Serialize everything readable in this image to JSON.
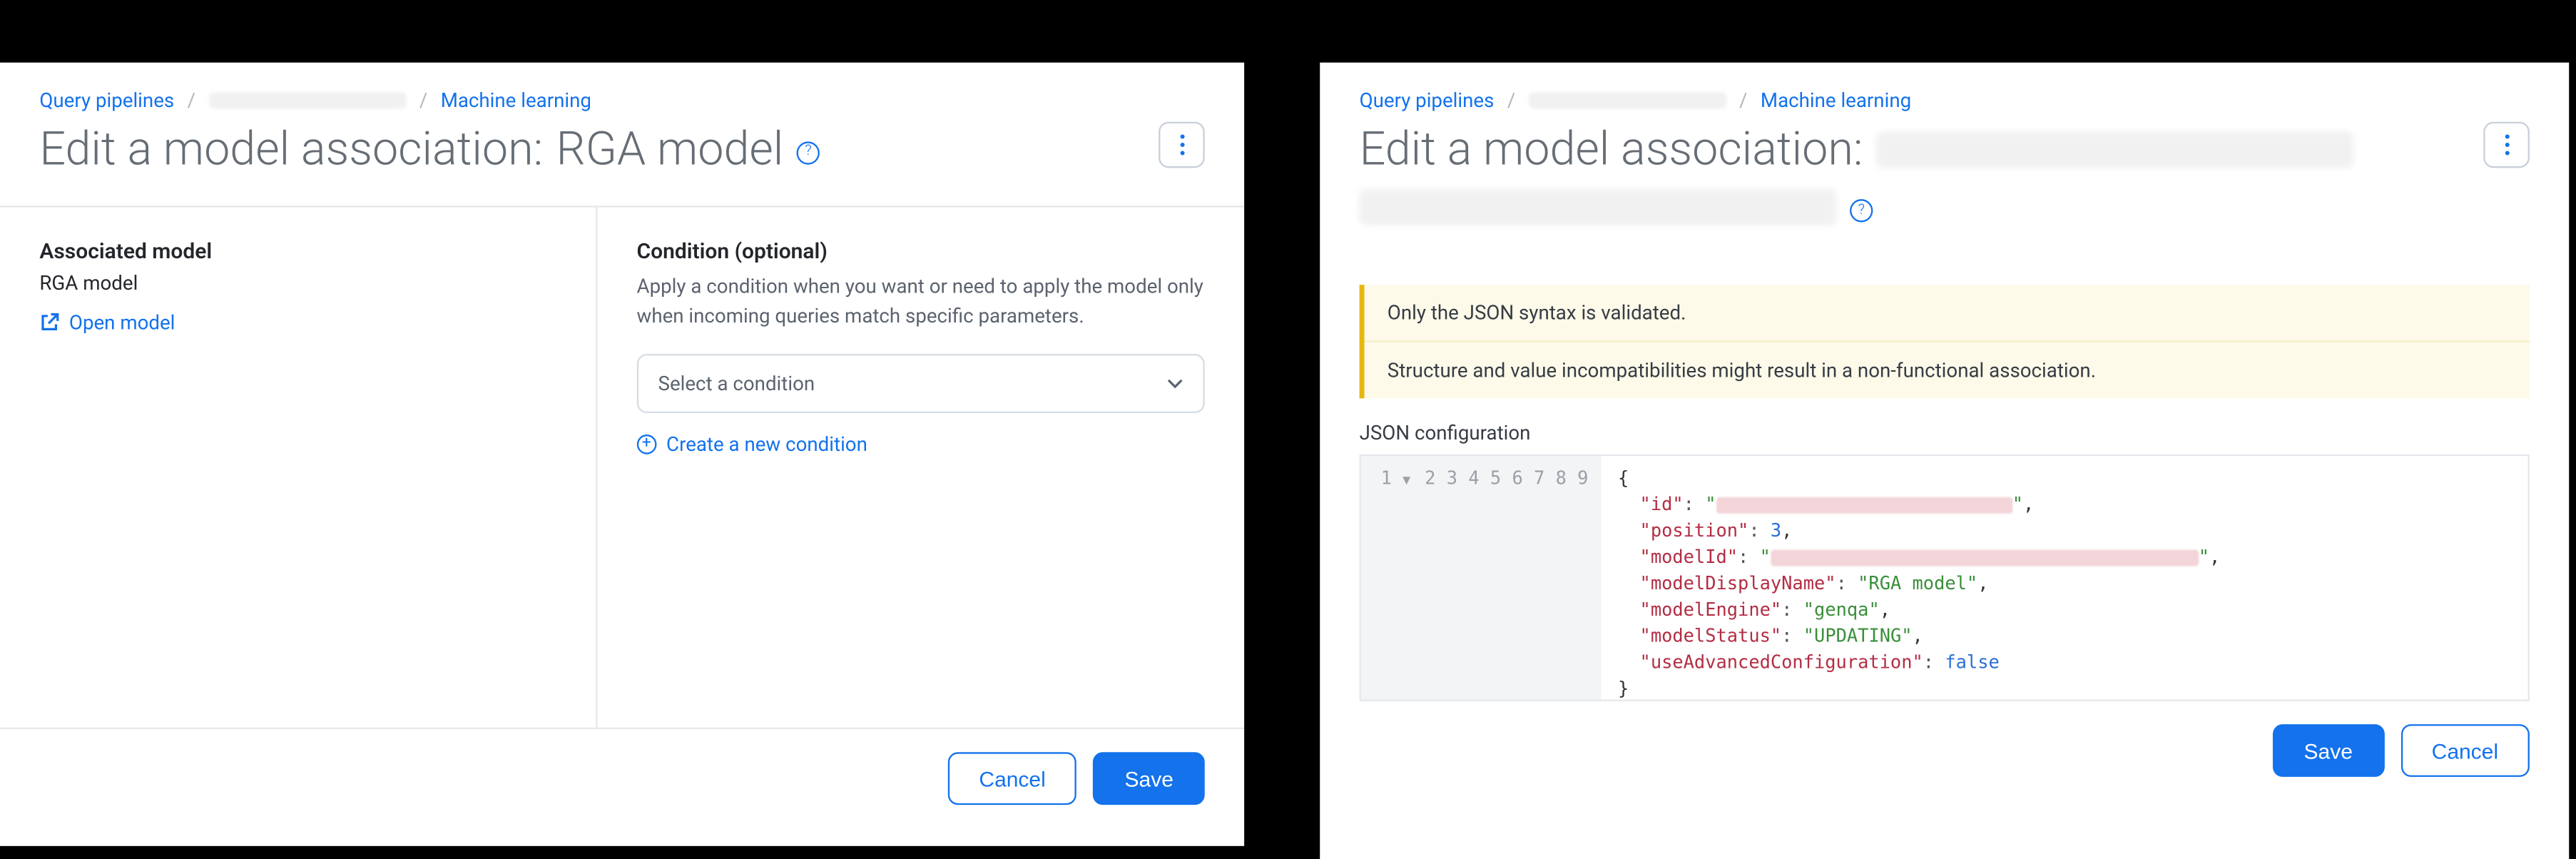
{
  "left": {
    "breadcrumb": {
      "root": "Query pipelines",
      "ml": "Machine learning"
    },
    "title_prefix": "Edit a model association:",
    "title_model": "RGA model",
    "associated": {
      "heading": "Associated model",
      "model_name": "RGA model",
      "open_link": "Open model"
    },
    "condition": {
      "heading": "Condition (optional)",
      "description": "Apply a condition when you want or need to apply the model only when incoming queries match specific parameters.",
      "select_placeholder": "Select a condition",
      "create_link": "Create a new condition"
    },
    "footer": {
      "cancel": "Cancel",
      "save": "Save"
    }
  },
  "right": {
    "breadcrumb": {
      "root": "Query pipelines",
      "ml": "Machine learning"
    },
    "title_prefix": "Edit a model association:",
    "warning": {
      "line1": "Only the JSON syntax is validated.",
      "line2": "Structure and value incompatibilities might result in a non-functional association."
    },
    "json_label": "JSON configuration",
    "code": {
      "line_numbers": [
        "1",
        "2",
        "3",
        "4",
        "5",
        "6",
        "7",
        "8",
        "9"
      ],
      "keys": {
        "id": "id",
        "position": "position",
        "modelId": "modelId",
        "modelDisplayName": "modelDisplayName",
        "modelEngine": "modelEngine",
        "modelStatus": "modelStatus",
        "useAdvancedConfiguration": "useAdvancedConfiguration"
      },
      "values": {
        "position": "3",
        "modelDisplayName": "RGA model",
        "modelEngine": "genqa",
        "modelStatus": "UPDATING",
        "useAdvancedConfiguration": "false"
      }
    },
    "footer": {
      "save": "Save",
      "cancel": "Cancel"
    }
  }
}
